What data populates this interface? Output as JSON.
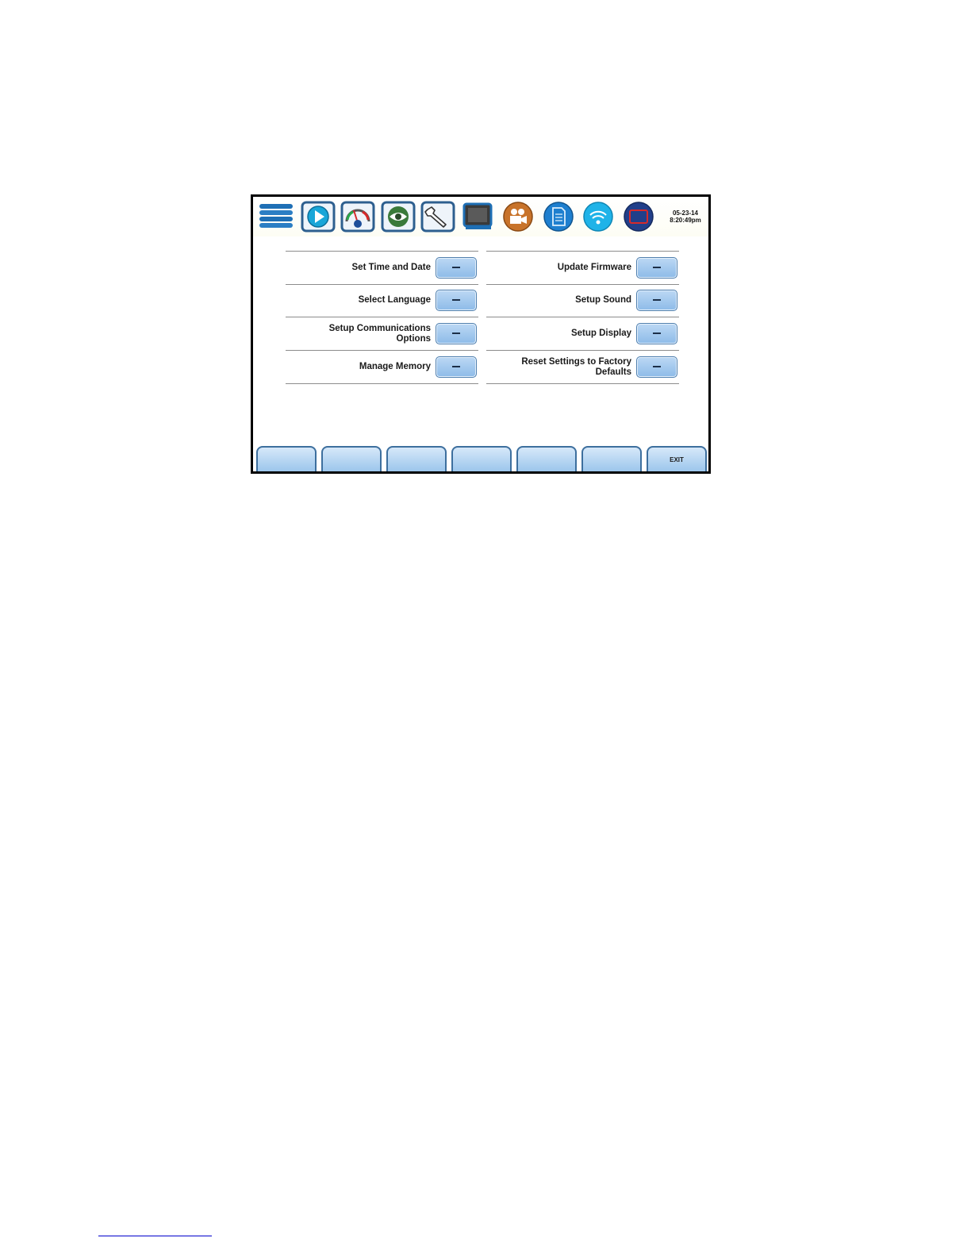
{
  "datetime": {
    "date": "05-23-14",
    "time": "8:20:49pm"
  },
  "toolbar_icons": [
    "menu-stack-icon",
    "play-icon",
    "gauge-meter-icon",
    "eye-icon",
    "wrench-icon",
    "monitor-icon",
    "camera-icon",
    "document-icon",
    "wireless-icon",
    "screen-rectangle-icon"
  ],
  "colors": {
    "accent": "#1e6fb5",
    "button_blue": "#9cc6ec",
    "orange": "#c8732a"
  },
  "menu": {
    "left": [
      {
        "label": "Set Time and Date"
      },
      {
        "label": "Select Language"
      },
      {
        "label": "Setup Communications Options"
      },
      {
        "label": "Manage Memory"
      }
    ],
    "right": [
      {
        "label": "Update Firmware"
      },
      {
        "label": "Setup Sound"
      },
      {
        "label": "Setup Display"
      },
      {
        "label": "Reset Settings to Factory Defaults"
      }
    ]
  },
  "softkeys": [
    "",
    "",
    "",
    "",
    "",
    "",
    "EXIT"
  ]
}
